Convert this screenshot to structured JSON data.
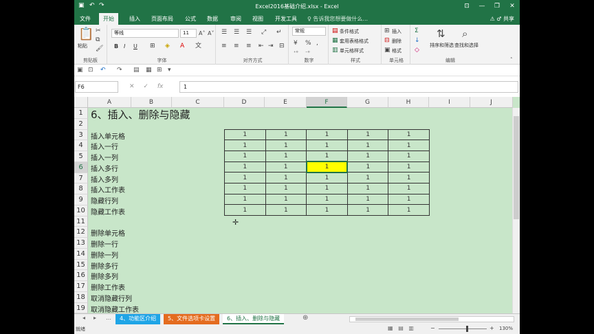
{
  "window": {
    "title": "Excel2016基础介绍.xlsx - Excel",
    "buttons": [
      "⊡",
      "—",
      "❐",
      "✕"
    ]
  },
  "tabs": [
    "文件",
    "开始",
    "插入",
    "页面布局",
    "公式",
    "数据",
    "审阅",
    "视图",
    "开发工具"
  ],
  "tellme": "♀ 告诉我您想要做什么...",
  "share": "⚠  ♂ 共享",
  "ribbon": {
    "clipboard": {
      "label": "剪贴板",
      "paste": "粘贴"
    },
    "font": {
      "label": "字体",
      "name": "等线",
      "size": "11",
      "bold": "B",
      "italic": "I",
      "underline": "U"
    },
    "alignment": {
      "label": "对齐方式"
    },
    "number": {
      "label": "数字",
      "format": "常规"
    },
    "styles": {
      "label": "样式",
      "conditional": "条件格式",
      "table": "套用表格格式",
      "cell": "单元格样式"
    },
    "cells": {
      "label": "单元格",
      "insert": "插入",
      "delete": "删除",
      "format": "格式"
    },
    "editing": {
      "label": "编辑",
      "sort": "排序和筛选",
      "find": "查找和选择"
    }
  },
  "namebox": "F6",
  "formula": "1",
  "columns": [
    "A",
    "B",
    "C",
    "D",
    "E",
    "F",
    "G",
    "H",
    "I",
    "J"
  ],
  "rows": [
    "1",
    "2",
    "3",
    "4",
    "5",
    "6",
    "7",
    "8",
    "9",
    "10",
    "11",
    "12",
    "13",
    "14",
    "15",
    "16",
    "17",
    "18",
    "19"
  ],
  "cells": {
    "a1": "6、插入、删除与隐藏",
    "a3": "插入单元格",
    "a4": "插入一行",
    "a5": "插入一列",
    "a6": "插入多行",
    "a7": "插入多列",
    "a8": "插入工作表",
    "a9": "隐藏行列",
    "a10": "隐藏工作表",
    "a12": "删除单元格",
    "a13": "删除一行",
    "a14": "删除一列",
    "a15": "删除多行",
    "a16": "删除多列",
    "a17": "删除工作表",
    "a18": "取消隐藏行列",
    "a19": "取消隐藏工作表"
  },
  "table_values": [
    [
      "1",
      "1",
      "1",
      "1",
      "1"
    ],
    [
      "1",
      "1",
      "1",
      "1",
      "1"
    ],
    [
      "1",
      "1",
      "1",
      "1",
      "1"
    ],
    [
      "1",
      "1",
      "1",
      "1",
      "1"
    ],
    [
      "1",
      "1",
      "1",
      "1",
      "1"
    ],
    [
      "1",
      "1",
      "1",
      "1",
      "1"
    ],
    [
      "1",
      "1",
      "1",
      "1",
      "1"
    ],
    [
      "1",
      "1",
      "1",
      "1",
      "1"
    ]
  ],
  "sheets": [
    {
      "label": "4、功能区介绍",
      "color": "#1fa5e6"
    },
    {
      "label": "5、文件选项卡设置",
      "color": "#e46c1f"
    },
    {
      "label": "6、插入、删除与隐藏",
      "color": "#ffffff"
    }
  ],
  "status": {
    "ready": "就绪",
    "zoom": "130%"
  },
  "colors": {
    "brand": "#217346",
    "grid": "#c8e6c9",
    "highlight": "#ffff00"
  }
}
